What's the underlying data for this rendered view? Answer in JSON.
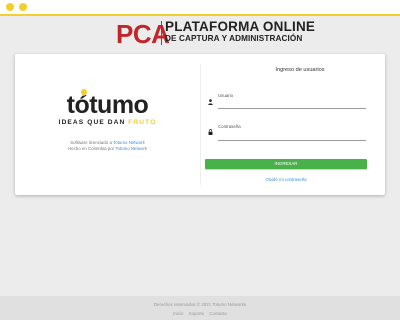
{
  "colors": {
    "accent": "#f2cf2a",
    "brand_red": "#c0272d",
    "button_green": "#48b14a",
    "link_blue": "#3a8fd8"
  },
  "header": {
    "acronym": "PCA",
    "title_line1": "PLATAFORMA ONLINE",
    "title_line2": "DE CAPTURA Y ADMINISTRACIÓN"
  },
  "brand": {
    "logo_word": "tótumo",
    "tagline_part1": "IDEAS QUE DAN ",
    "tagline_part2": "FRUTO",
    "licence_prefix": "Software licenciado a ",
    "licence_link": "Totumo Network",
    "made_prefix": "Hecho en Colombia por ",
    "made_link": "Totumo Network"
  },
  "login": {
    "title": "Ingreso de usuarios",
    "user_label": "Usuario",
    "user_value": "",
    "password_label": "Contraseña",
    "password_value": "",
    "submit_label": "INGRESAR",
    "forgot_label": "Olvidé mi contraseña",
    "icons": {
      "user": "user-icon",
      "password": "lock-icon"
    }
  },
  "footer": {
    "copyright": "Derechos reservados © 2021 Totumo Networks",
    "links": [
      "Inicio",
      "Soporte",
      "Contacto"
    ]
  }
}
